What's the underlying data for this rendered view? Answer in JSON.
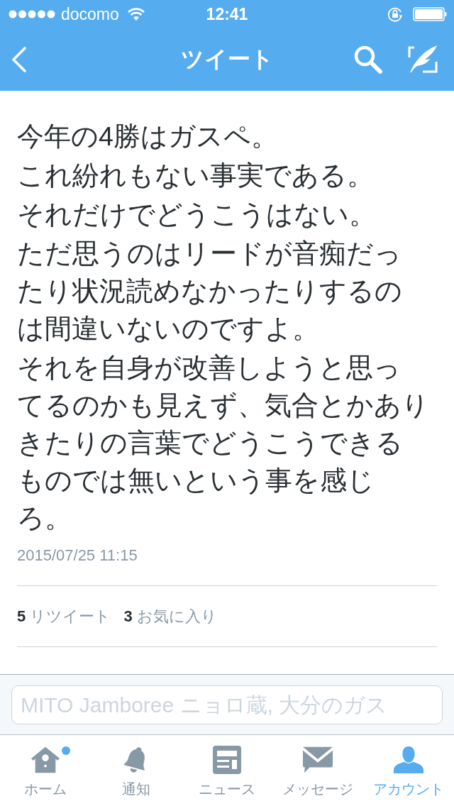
{
  "status_bar": {
    "carrier": "docomo",
    "time": "12:41"
  },
  "nav_bar": {
    "title": "ツイート"
  },
  "tweet": {
    "paragraphs": [
      [
        "今年の4勝はガスペ。"
      ],
      [
        "これ紛れもない事実である。"
      ],
      [
        "それだけでどうこうはない。"
      ],
      [
        "ただ思うのはリードが音痴だっ",
        "たり状況読めなかったりするの",
        "は間違いないのですよ。"
      ],
      [
        "それを自身が改善しようと思っ",
        "てるのかも見えず、気合とかあり",
        "きたりの言葉でどうこうできる",
        "ものでは無いという事を感じ",
        "ろ。"
      ]
    ],
    "timestamp": "2015/07/25 11:15",
    "stats": [
      {
        "count": "5",
        "label": "リツイート"
      },
      {
        "count": "3",
        "label": "お気に入り"
      }
    ]
  },
  "reply_bar": {
    "placeholder": "MITO Jamboree ニョロ蔵, 大分のガス"
  },
  "tab_bar": {
    "items": [
      {
        "kind": "home",
        "label": "ホーム",
        "selected": false,
        "badge": true
      },
      {
        "kind": "notifications",
        "label": "通知",
        "selected": false,
        "badge": false
      },
      {
        "kind": "news",
        "label": "ニュース",
        "selected": false,
        "badge": false
      },
      {
        "kind": "messages",
        "label": "メッセージ",
        "selected": false,
        "badge": false
      },
      {
        "kind": "account",
        "label": "アカウント",
        "selected": true,
        "badge": false
      }
    ]
  }
}
